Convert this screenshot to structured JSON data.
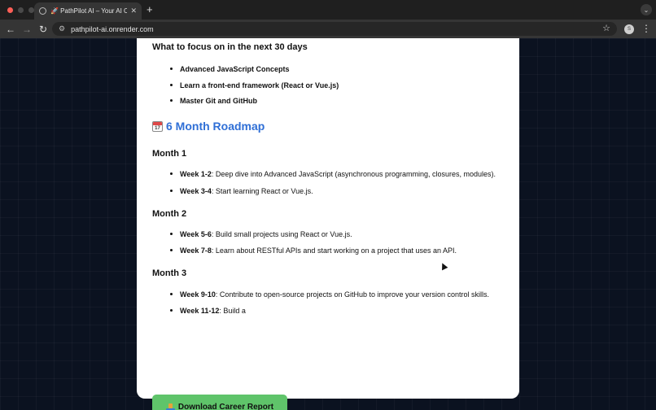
{
  "browser": {
    "tab": {
      "title": "🚀 PathPilot AI – Your AI Care",
      "close": "✕"
    },
    "new_tab": "+",
    "tab_menu": "⌄",
    "nav": {
      "back": "←",
      "forward": "→",
      "reload": "↻"
    },
    "site_info_icon": "⚙",
    "url": "pathpilot-ai.onrender.com",
    "bookmark_icon": "☆",
    "profile_initial": "S",
    "menu_icon": "⋮"
  },
  "content": {
    "focus_heading": "What to focus on in the next 30 days",
    "focus_items": [
      "Advanced JavaScript Concepts",
      "Learn a front-end framework (React or Vue.js)",
      "Master Git and GitHub"
    ],
    "roadmap_icon_text": "17",
    "roadmap_title": "6 Month Roadmap",
    "months": [
      {
        "title": "Month 1",
        "weeks": [
          {
            "label": "Week 1-2",
            "text": ": Deep dive into Advanced JavaScript (asynchronous programming, closures, modules)."
          },
          {
            "label": "Week 3-4",
            "text": ": Start learning React or Vue.js."
          }
        ]
      },
      {
        "title": "Month 2",
        "weeks": [
          {
            "label": "Week 5-6",
            "text": ": Build small projects using React or Vue.js."
          },
          {
            "label": "Week 7-8",
            "text": ": Learn about RESTful APIs and start working on a project that uses an API."
          }
        ]
      },
      {
        "title": "Month 3",
        "weeks": [
          {
            "label": "Week 9-10",
            "text": ": Contribute to open-source projects on GitHub to improve your version control skills."
          },
          {
            "label": "Week 11-12",
            "text": ": Build a"
          }
        ]
      }
    ],
    "download_button": "Download Career Report"
  }
}
